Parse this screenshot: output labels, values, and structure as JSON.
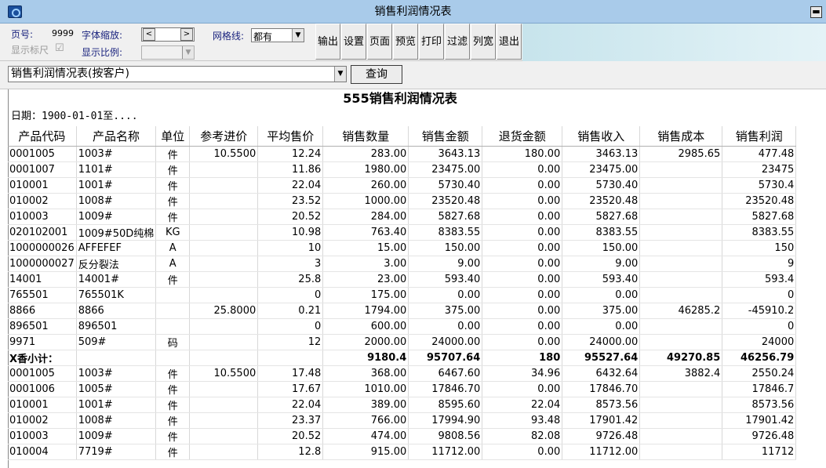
{
  "window": {
    "title": "销售利润情况表",
    "menu_glyph": "▬"
  },
  "toolbar": {
    "page_label": "页号:",
    "page_value": "9999",
    "font_scale_label": "字体缩放:",
    "show_ruler_label": "显示标尺",
    "show_ratio_label": "显示比例:",
    "gridline_label": "网格线:",
    "gridline_value": "都有",
    "buttons": [
      "输出",
      "设置",
      "页面",
      "预览",
      "打印",
      "过滤",
      "列宽",
      "退出"
    ]
  },
  "query": {
    "report_value": "销售利润情况表(按客户)",
    "query_button": "查询"
  },
  "report": {
    "title": "555销售利润情况表",
    "date_line": "日期：1900-01-01至....",
    "columns": [
      "产品代码",
      "产品名称",
      "单位",
      "参考进价",
      "平均售价",
      "销售数量",
      "销售金额",
      "退货金额",
      "销售收入",
      "销售成本",
      "销售利润"
    ],
    "rows": [
      [
        "0001005",
        "1003#",
        "件",
        "10.5500",
        "12.24",
        "283.00",
        "3643.13",
        "180.00",
        "3463.13",
        "2985.65",
        "477.48"
      ],
      [
        "0001007",
        "1101#",
        "件",
        "",
        "11.86",
        "1980.00",
        "23475.00",
        "0.00",
        "23475.00",
        "",
        "23475"
      ],
      [
        "010001",
        "1001#",
        "件",
        "",
        "22.04",
        "260.00",
        "5730.40",
        "0.00",
        "5730.40",
        "",
        "5730.4"
      ],
      [
        "010002",
        "1008#",
        "件",
        "",
        "23.52",
        "1000.00",
        "23520.48",
        "0.00",
        "23520.48",
        "",
        "23520.48"
      ],
      [
        "010003",
        "1009#",
        "件",
        "",
        "20.52",
        "284.00",
        "5827.68",
        "0.00",
        "5827.68",
        "",
        "5827.68"
      ],
      [
        "020102001",
        "1009#50D纯棉",
        "KG",
        "",
        "10.98",
        "763.40",
        "8383.55",
        "0.00",
        "8383.55",
        "",
        "8383.55"
      ],
      [
        "1000000026",
        "AFFEFEF",
        "A",
        "",
        "10",
        "15.00",
        "150.00",
        "0.00",
        "150.00",
        "",
        "150"
      ],
      [
        "1000000027",
        "反分裂法",
        "A",
        "",
        "3",
        "3.00",
        "9.00",
        "0.00",
        "9.00",
        "",
        "9"
      ],
      [
        "14001",
        "14001#",
        "件",
        "",
        "25.8",
        "23.00",
        "593.40",
        "0.00",
        "593.40",
        "",
        "593.4"
      ],
      [
        "765501",
        "765501K",
        "",
        "",
        "0",
        "175.00",
        "0.00",
        "0.00",
        "0.00",
        "",
        "0"
      ],
      [
        "8866",
        "8866",
        "",
        "25.8000",
        "0.21",
        "1794.00",
        "375.00",
        "0.00",
        "375.00",
        "46285.2",
        "-45910.2"
      ],
      [
        "896501",
        "896501",
        "",
        "",
        "0",
        "600.00",
        "0.00",
        "0.00",
        "0.00",
        "",
        "0"
      ],
      [
        "9971",
        "509#",
        "码",
        "",
        "12",
        "2000.00",
        "24000.00",
        "0.00",
        "24000.00",
        "",
        "24000"
      ],
      [
        "X香小计：",
        "",
        "",
        "",
        "",
        "9180.4",
        "95707.64",
        "180",
        "95527.64",
        "49270.85",
        "46256.79"
      ],
      [
        "0001005",
        "1003#",
        "件",
        "10.5500",
        "17.48",
        "368.00",
        "6467.60",
        "34.96",
        "6432.64",
        "3882.4",
        "2550.24"
      ],
      [
        "0001006",
        "1005#",
        "件",
        "",
        "17.67",
        "1010.00",
        "17846.70",
        "0.00",
        "17846.70",
        "",
        "17846.7"
      ],
      [
        "010001",
        "1001#",
        "件",
        "",
        "22.04",
        "389.00",
        "8595.60",
        "22.04",
        "8573.56",
        "",
        "8573.56"
      ],
      [
        "010002",
        "1008#",
        "件",
        "",
        "23.37",
        "766.00",
        "17994.90",
        "93.48",
        "17901.42",
        "",
        "17901.42"
      ],
      [
        "010003",
        "1009#",
        "件",
        "",
        "20.52",
        "474.00",
        "9808.56",
        "82.08",
        "9726.48",
        "",
        "9726.48"
      ],
      [
        "010004",
        "7719#",
        "件",
        "",
        "12.8",
        "915.00",
        "11712.00",
        "0.00",
        "11712.00",
        "",
        "11712"
      ]
    ],
    "subtotal_row_index": 13
  }
}
